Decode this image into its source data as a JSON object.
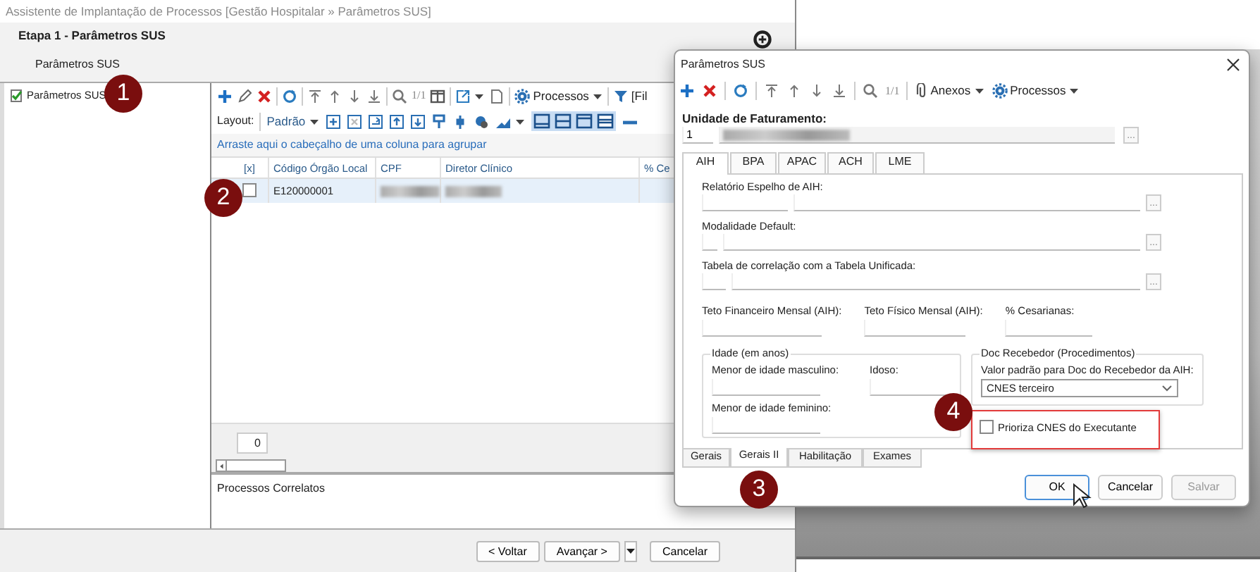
{
  "main_window": {
    "title": "Assistente de Implantação de Processos [Gestão Hospitalar » Parâmetros SUS]",
    "step_title": "Etapa 1 - Parâmetros SUS",
    "step_subtitle": "Parâmetros SUS",
    "tree": [
      {
        "label": "Parâmetros SUS",
        "selected": false
      }
    ],
    "toolbar": {
      "page_indicator": "1/1",
      "processes_menu": "Processos",
      "filter_label": "[Fil"
    },
    "layout_label": "Layout:",
    "layout_value": "Padrão",
    "view_toggles": [
      {
        "selected": true
      },
      {
        "selected": true
      },
      {
        "selected": true
      },
      {
        "selected": true
      }
    ],
    "group_hint": "Arraste aqui o cabeçalho de uma coluna para agrupar",
    "table": {
      "columns": [
        "[x]",
        "Código Órgão Local",
        "CPF",
        "Diretor Clínico",
        "% Ce"
      ],
      "rows": [
        {
          "selected": true,
          "cells": [
            {
              "kind": "checkbox",
              "checked": false
            },
            {
              "kind": "text",
              "text": "E120000001"
            },
            {
              "kind": "redacted"
            },
            {
              "kind": "redacted"
            }
          ]
        }
      ]
    },
    "record_count": "0",
    "related_title": "Processos Correlatos",
    "footer_buttons": [
      {
        "kind": "button",
        "label": "< Voltar"
      },
      {
        "kind": "button",
        "label": "Avançar >"
      },
      {
        "kind": "dropdown"
      },
      {
        "kind": "button",
        "label": "Cancelar"
      }
    ]
  },
  "dialog": {
    "title": "Parâmetros SUS",
    "toolbar": {
      "page_indicator": "1/1",
      "menus": [
        "Anexos",
        "Processos"
      ]
    },
    "billing_unit": {
      "label": "Unidade de Faturamento:",
      "code": "1",
      "name_redacted": true,
      "button": "..."
    },
    "top_tabs": [
      {
        "label": "AIH",
        "selected": true
      },
      {
        "label": "BPA",
        "selected": false
      },
      {
        "label": "APAC",
        "selected": false
      },
      {
        "label": "ACH",
        "selected": false
      },
      {
        "label": "LME",
        "selected": false
      }
    ],
    "lookups": [
      {
        "label": "Relatório Espelho de AIH:",
        "button": "..."
      },
      {
        "label": "Modalidade Default:",
        "button": "..."
      },
      {
        "label": "Tabela de correlação com a Tabela Unificada:",
        "button": "..."
      }
    ],
    "limits": [
      {
        "label": "Teto Financeiro Mensal (AIH):"
      },
      {
        "label": "Teto Físico Mensal (AIH):"
      },
      {
        "label": "% Cesarianas:"
      }
    ],
    "age_group": {
      "title": "Idade (em anos)",
      "fields": [
        {
          "label": "Menor de idade masculino:"
        },
        {
          "label": "Idoso:"
        },
        {
          "label": "Menor de idade feminino:"
        }
      ]
    },
    "receiver_group": {
      "title": "Doc Recebedor (Procedimentos)",
      "label": "Valor padrão para Doc do Recebedor da AIH:",
      "value": "CNES terceiro"
    },
    "prioritize": {
      "label": "Prioriza CNES do Executante",
      "checked": false,
      "highlighted": true
    },
    "bottom_tabs": [
      {
        "label": "Gerais",
        "selected": false
      },
      {
        "label": "Gerais II",
        "selected": true
      },
      {
        "label": "Habilitação",
        "selected": false
      },
      {
        "label": "Exames",
        "selected": false
      }
    ],
    "buttons": [
      {
        "label": "OK",
        "default": true,
        "disabled": false
      },
      {
        "label": "Cancelar",
        "default": false,
        "disabled": false
      },
      {
        "label": "Salvar",
        "default": false,
        "disabled": true
      }
    ]
  },
  "annotations": [
    {
      "label": "1"
    },
    {
      "label": "2"
    },
    {
      "label": "3"
    },
    {
      "label": "4"
    }
  ]
}
